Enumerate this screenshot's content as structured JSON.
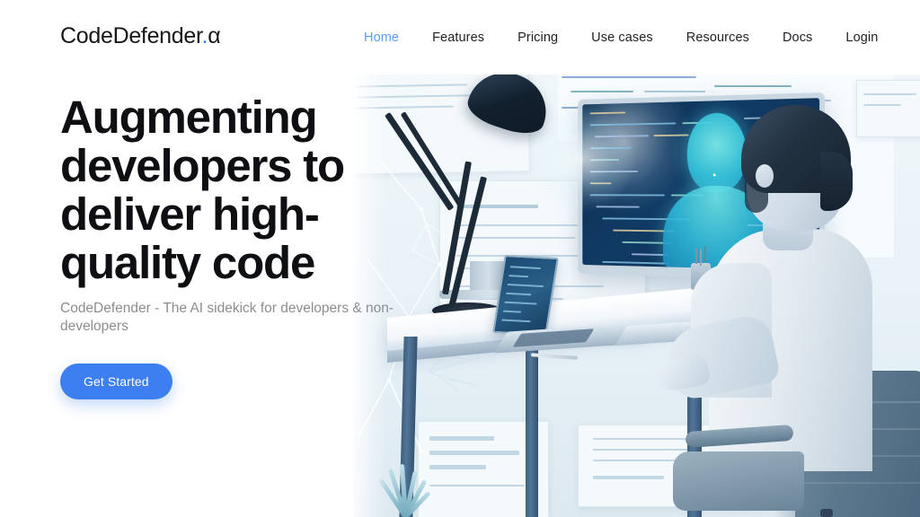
{
  "brand": {
    "name_main": "CodeDefender",
    "dot": ".",
    "suffix": "α",
    "accent_color": "#3d7ef0"
  },
  "nav": {
    "items": [
      {
        "label": "Home",
        "active": true
      },
      {
        "label": "Features",
        "active": false
      },
      {
        "label": "Pricing",
        "active": false
      },
      {
        "label": "Use cases",
        "active": false
      },
      {
        "label": "Resources",
        "active": false
      },
      {
        "label": "Docs",
        "active": false
      },
      {
        "label": "Login",
        "active": false
      }
    ],
    "active_color": "#5b9bf5",
    "default_color": "#1d2026"
  },
  "hero": {
    "headline": "Augmenting developers to deliver high-quality code",
    "subhead": "CodeDefender - The AI sidekick for developers & non-developers",
    "cta_label": "Get Started",
    "cta_bg": "#3d7ef0",
    "cta_text_color": "#ffffff",
    "subhead_color": "#8b8d90",
    "headline_color": "#0d0f12"
  },
  "illustration": {
    "alt": "Developer seated at a white desk typing on a keyboard, facing a monitor displaying code and a glowing cyan particle silhouette of a human head, with an articulated desk lamp, a laptop, and documents on the wall behind",
    "scene_elements": [
      "desk-lamp",
      "monitor",
      "ai-particle-head",
      "code-editor",
      "laptop",
      "keyboard",
      "developer-person",
      "office-chair",
      "wall-documents",
      "network-constellation",
      "plant"
    ],
    "palette": {
      "background": "#e7f1f7",
      "screen_dark": "#0d2f52",
      "ai_cyan": "#39c9e0",
      "desk_leg": "#3e5f7d",
      "chair": "#5d798e"
    }
  }
}
